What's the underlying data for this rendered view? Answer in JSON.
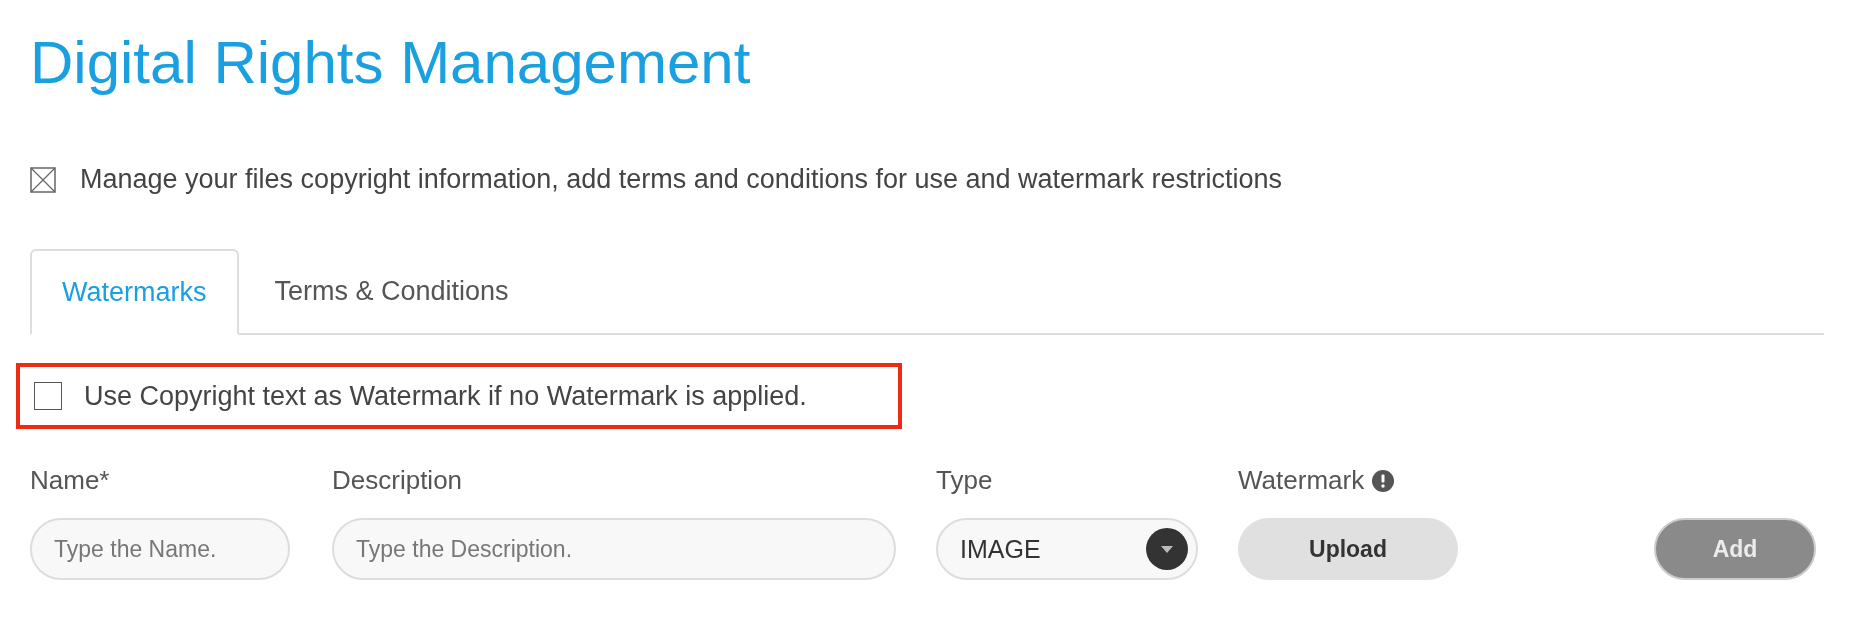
{
  "page": {
    "title": "Digital Rights Management",
    "description": "Manage your files copyright information, add terms and conditions for use and watermark restrictions"
  },
  "tabs": [
    {
      "label": "Watermarks",
      "selected": true
    },
    {
      "label": "Terms & Conditions",
      "selected": false
    }
  ],
  "copyright_option": {
    "label": "Use Copyright text as Watermark if no Watermark is applied.",
    "checked": false,
    "highlighted": true
  },
  "form": {
    "name": {
      "label": "Name*",
      "placeholder": "Type the Name."
    },
    "description": {
      "label": "Description",
      "placeholder": "Type the Description."
    },
    "type": {
      "label": "Type",
      "value": "IMAGE"
    },
    "watermark": {
      "label": "Watermark",
      "button": "Upload"
    },
    "add_button": {
      "label": "Add",
      "disabled": true
    }
  }
}
